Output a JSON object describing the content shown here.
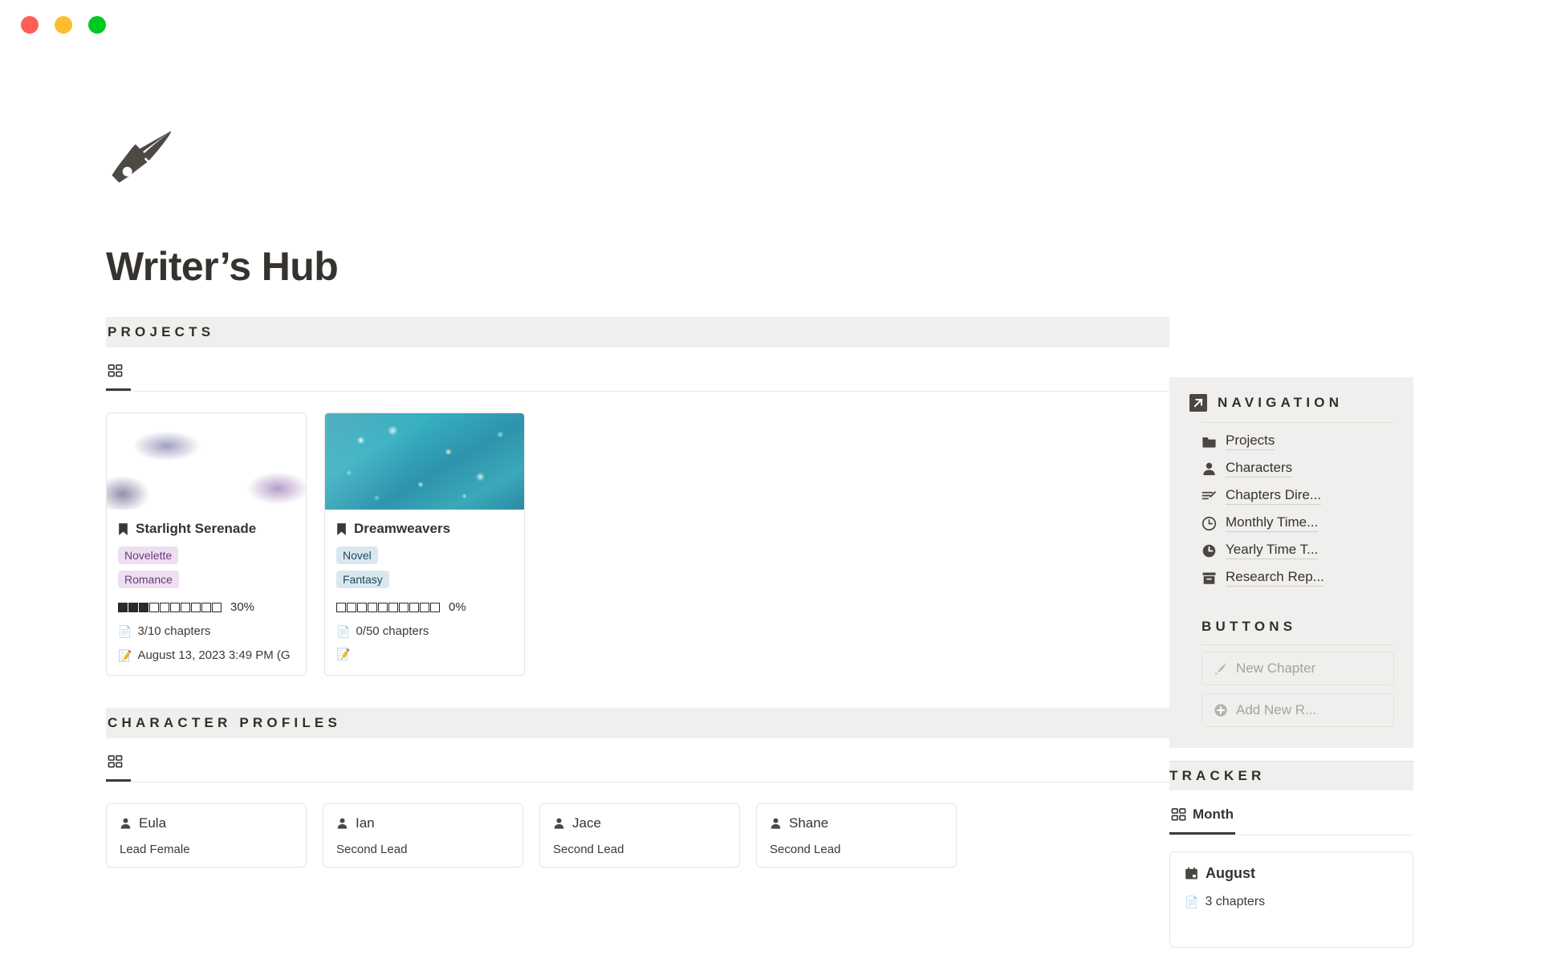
{
  "window": {
    "controls": [
      {
        "name": "close",
        "color": "#ff5f57"
      },
      {
        "name": "minimize",
        "color": "#ffbd2e"
      },
      {
        "name": "maximize",
        "color": "#00ca1f"
      }
    ]
  },
  "header": {
    "icon": "fountain-pen-nib-icon",
    "title": "Writer’s Hub"
  },
  "projects_section": {
    "label": "PROJECTS",
    "tabs": [
      {
        "icon": "gallery-grid-icon",
        "label": "",
        "active": true
      }
    ],
    "cards": [
      {
        "cover": "purple-nebula-sky",
        "icon": "bookmark-icon",
        "title": "Starlight Serenade",
        "tags": [
          {
            "text": "Novelette",
            "color": "purple"
          },
          {
            "text": "Romance",
            "color": "purple"
          }
        ],
        "progress_filled": 3,
        "progress_total": 10,
        "progress_label": "30%",
        "chapters_emoji": "📄",
        "chapters": "3/10 chapters",
        "date_emoji": "📝",
        "date": "August 13, 2023 3:49 PM (G"
      },
      {
        "cover": "teal-glitter-bokeh",
        "icon": "bookmark-icon",
        "title": "Dreamweavers",
        "tags": [
          {
            "text": "Novel",
            "color": "blue"
          },
          {
            "text": "Fantasy",
            "color": "blue"
          }
        ],
        "progress_filled": 0,
        "progress_total": 10,
        "progress_label": "0%",
        "chapters_emoji": "📄",
        "chapters": "0/50 chapters",
        "date_emoji": "📝",
        "date": ""
      }
    ]
  },
  "characters_section": {
    "label": "CHARACTER PROFILES",
    "tabs": [
      {
        "icon": "gallery-grid-icon",
        "label": "",
        "active": true
      }
    ],
    "cards": [
      {
        "icon": "person-icon",
        "name": "Eula",
        "role": "Lead Female"
      },
      {
        "icon": "person-icon",
        "name": "Ian",
        "role": "Second Lead"
      },
      {
        "icon": "person-icon",
        "name": "Jace",
        "role": "Second Lead"
      },
      {
        "icon": "person-icon",
        "name": "Shane",
        "role": "Second Lead"
      }
    ]
  },
  "navigation": {
    "icon": "arrow-up-right-box-icon",
    "label": "NAVIGATION",
    "items": [
      {
        "icon": "folder-icon",
        "label": "Projects"
      },
      {
        "icon": "person-icon",
        "label": "Characters"
      },
      {
        "icon": "list-pencil-icon",
        "label": "Chapters Dire..."
      },
      {
        "icon": "clock-outline-icon",
        "label": "Monthly Time..."
      },
      {
        "icon": "clock-filled-icon",
        "label": "Yearly Time T..."
      },
      {
        "icon": "archive-box-icon",
        "label": "Research Rep..."
      }
    ]
  },
  "buttons_section": {
    "label": "BUTTONS",
    "buttons": [
      {
        "icon": "pen-nib-icon",
        "label": "New Chapter",
        "disabled": true
      },
      {
        "icon": "plus-circle-icon",
        "label": "Add New R...",
        "disabled": true
      }
    ]
  },
  "tracker_section": {
    "label": "TRACKER",
    "tabs": [
      {
        "icon": "gallery-grid-icon",
        "label": "Month",
        "active": true
      }
    ],
    "cards": [
      {
        "icon": "calendar-icon",
        "title": "August",
        "chapters_emoji": "📄",
        "chapters": "3 chapters"
      }
    ]
  },
  "colors": {
    "section_bar": "#F0EFED",
    "text": "#36332E",
    "tag_purple_bg": "#EDDFEF",
    "tag_blue_bg": "#D9E8EF",
    "accent_underline": "#3F3C37"
  }
}
